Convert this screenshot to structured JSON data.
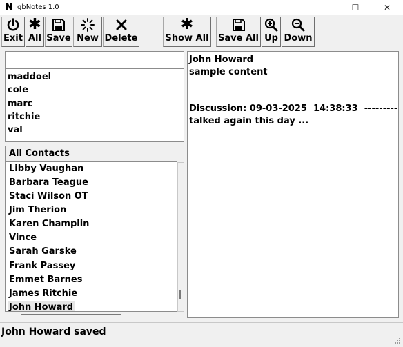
{
  "window": {
    "app_icon_letter": "N",
    "title": "gbNotes 1.0",
    "minimize_glyph": "—",
    "maximize_glyph": "☐",
    "close_glyph": "✕"
  },
  "toolbar": {
    "exit_label": "Exit",
    "all_label": "All",
    "save_label": "Save",
    "new_label": "New",
    "delete_label": "Delete",
    "show_all_label": "Show All",
    "save_all_label": "Save All",
    "up_label": "Up",
    "down_label": "Down"
  },
  "search": {
    "value": ""
  },
  "recent_contacts": [
    "maddoel",
    "cole",
    "marc",
    "ritchie",
    "val"
  ],
  "contacts": {
    "header": "All Contacts",
    "items": [
      "Libby Vaughan",
      "Barbara Teague",
      "Staci Wilson  OT",
      "Jim Therion",
      "Karen Champlin",
      "Vince",
      "Sarah Garske",
      "Frank Passey",
      "Emmet Barnes",
      "James Ritchie",
      "John Howard"
    ],
    "selected": "John Howard"
  },
  "note": {
    "line1": "John Howard",
    "line2": "sample content",
    "line3": "",
    "line4": "Discussion: 09-03-2025  14:38:33  ---------",
    "line5": "talked again this day ..."
  },
  "status": {
    "text": "John Howard saved"
  },
  "icons": {
    "exit": "power-icon",
    "all": "asterisk-icon",
    "save": "floppy-disk-icon",
    "new": "spinner-icon",
    "delete": "x-icon",
    "show_all": "asterisk-icon",
    "save_all": "floppy-disk-icon",
    "up": "zoom-in-icon",
    "down": "zoom-out-icon"
  }
}
